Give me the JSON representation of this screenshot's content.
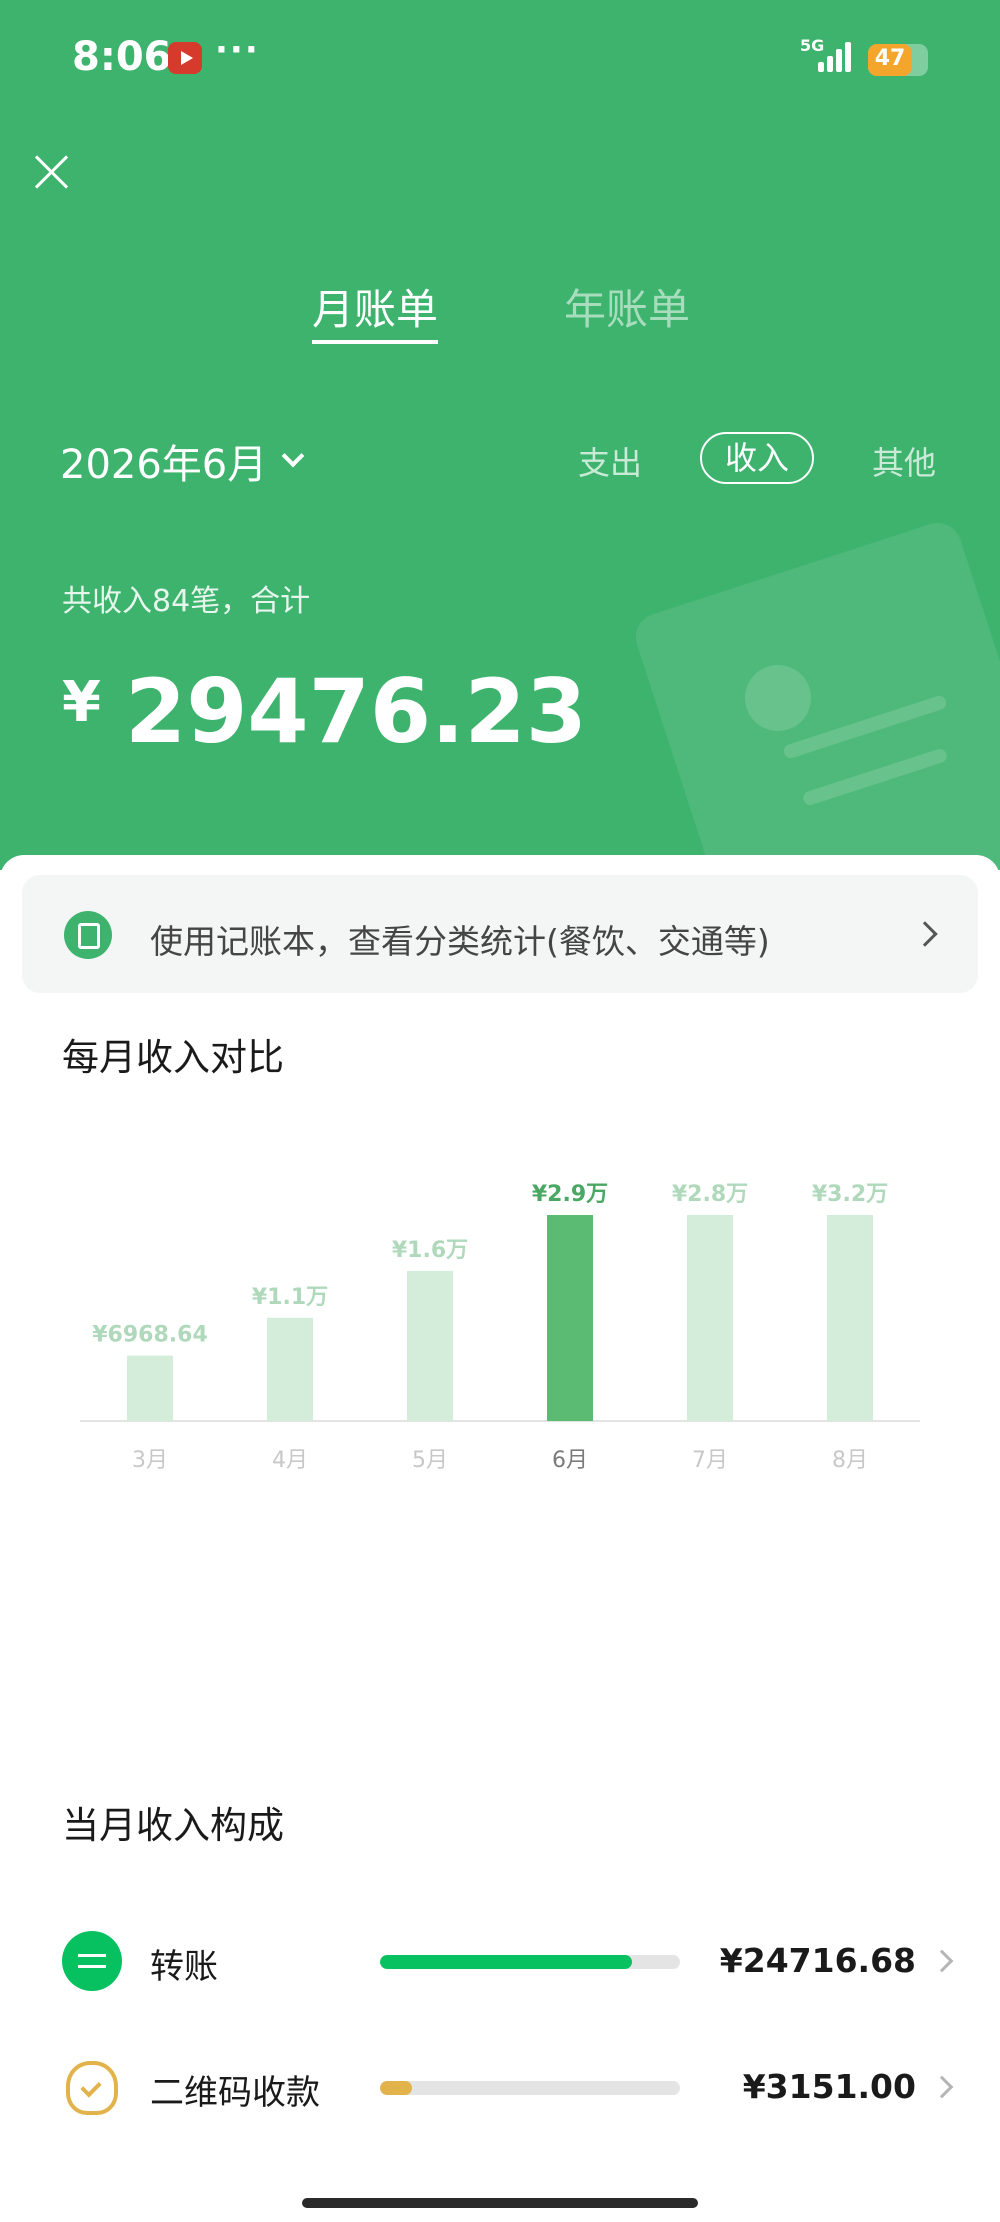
{
  "status_bar": {
    "time": "8:06",
    "dots": "···",
    "network": "5G",
    "battery": "47"
  },
  "tabs": {
    "monthly": "月账单",
    "yearly": "年账单"
  },
  "period": {
    "selected": "2026年6月"
  },
  "filters": {
    "expense": "支出",
    "income": "收入",
    "other": "其他"
  },
  "summary": {
    "text": "共收入84笔，合计",
    "currency": "¥",
    "total": "29476.23"
  },
  "banner": {
    "text": "使用记账本，查看分类统计(餐饮、交通等)"
  },
  "chart_section": {
    "title": "每月收入对比"
  },
  "chart_data": {
    "type": "bar",
    "categories": [
      "3月",
      "4月",
      "5月",
      "6月",
      "7月",
      "8月"
    ],
    "values": [
      6968.64,
      11000,
      16000,
      29000,
      28000,
      32000
    ],
    "value_labels": [
      "¥6968.64",
      "¥1.1万",
      "¥1.6万",
      "¥2.9万",
      "¥2.8万",
      "¥3.2万"
    ],
    "highlight_index": 3,
    "colors": {
      "bar": "#d4edda",
      "highlight": "#5cbb72",
      "label": "#b0d8bb",
      "highlight_label": "#4aa864",
      "axis": "#e3e3e3",
      "tick": "#c8c8c8"
    },
    "title": "",
    "xlabel": "",
    "ylabel": "",
    "ylim": [
      0,
      32000
    ]
  },
  "composition": {
    "title": "当月收入构成",
    "items": [
      {
        "label": "转账",
        "amount": "¥24716.68",
        "share": 0.8385,
        "color": "#07c160",
        "icon": "transfer-icon"
      },
      {
        "label": "二维码收款",
        "amount": "¥3151.00",
        "share": 0.107,
        "color": "#e2b34a",
        "icon": "money-bag-icon"
      }
    ]
  }
}
